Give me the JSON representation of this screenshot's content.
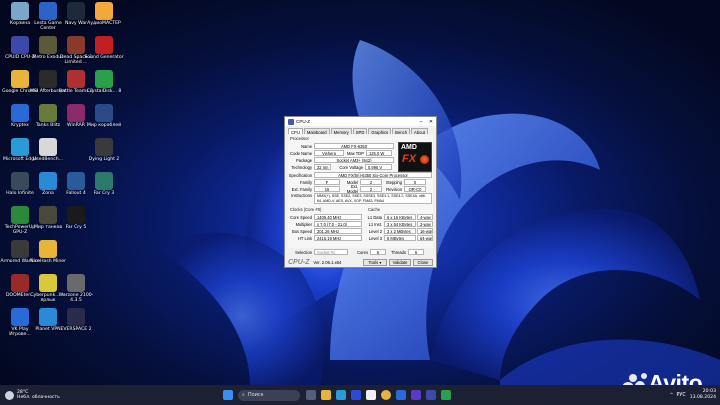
{
  "desktop_icons": [
    {
      "label": "Корзина",
      "color": "#7aa7c7",
      "name": "recycle-bin-icon",
      "col": 0,
      "row": 0
    },
    {
      "label": "Lesta Game Center",
      "color": "#2a64c8",
      "name": "lesta-game-center-icon",
      "col": 1,
      "row": 0
    },
    {
      "label": "Navy War",
      "color": "#1d2a3a",
      "name": "navy-war-icon",
      "col": 2,
      "row": 0
    },
    {
      "label": "АудиоМАСТЕР",
      "color": "#f2a83a",
      "name": "audiomaster-icon",
      "col": 3,
      "row": 0
    },
    {
      "label": "CPUID CPU-Z",
      "color": "#3b4aa8",
      "name": "cpu-z-icon",
      "col": 0,
      "row": 1
    },
    {
      "label": "Metro Exodus",
      "color": "#5a5a3a",
      "name": "metro-exodus-icon",
      "col": 1,
      "row": 1
    },
    {
      "label": "Dead Space 3 Limited ...",
      "color": "#8a3a2a",
      "name": "dead-space-icon",
      "col": 2,
      "row": 1
    },
    {
      "label": "Sound Generator",
      "color": "#c02020",
      "name": "sound-generator-icon",
      "col": 3,
      "row": 1
    },
    {
      "label": "Google Chrome",
      "color": "#e8b43a",
      "name": "chrome-icon",
      "col": 0,
      "row": 2
    },
    {
      "label": "MSI Afterburner",
      "color": "#2a2a2a",
      "name": "msi-afterburner-icon",
      "col": 1,
      "row": 2
    },
    {
      "label": "Battle Teams 2",
      "color": "#b03030",
      "name": "battle-teams-icon",
      "col": 2,
      "row": 2
    },
    {
      "label": "CrystalDisk... 8",
      "color": "#2aa04a",
      "name": "crystaldisk-icon",
      "col": 3,
      "row": 2
    },
    {
      "label": "Kryptex",
      "color": "#2a6ad8",
      "name": "kryptex-icon",
      "col": 0,
      "row": 3
    },
    {
      "label": "Tanks Blitz",
      "color": "#6a7a3a",
      "name": "tanks-blitz-icon",
      "col": 1,
      "row": 3
    },
    {
      "label": "WinRAR",
      "color": "#8a2a6a",
      "name": "winrar-icon",
      "col": 2,
      "row": 3
    },
    {
      "label": "Мир кораблей",
      "color": "#2a4a8a",
      "name": "mir-korabley-icon",
      "col": 3,
      "row": 3
    },
    {
      "label": "Microsoft Edge",
      "color": "#2a9ad8",
      "name": "edge-icon",
      "col": 0,
      "row": 4
    },
    {
      "label": "UsedBench...",
      "color": "#d8d8d8",
      "name": "userbenchmark-icon",
      "col": 1,
      "row": 4
    },
    {
      "label": "Dying Light 2",
      "color": "#3a3a3a",
      "name": "dying-light-icon",
      "col": 3,
      "row": 4
    },
    {
      "label": "Halo Infinite",
      "color": "#3a4a5a",
      "name": "halo-infinite-icon",
      "col": 0,
      "row": 5
    },
    {
      "label": "Zona",
      "color": "#2a8ad8",
      "name": "zona-icon",
      "col": 1,
      "row": 5
    },
    {
      "label": "Fallout 4",
      "color": "#2a5a9a",
      "name": "fallout4-icon",
      "col": 2,
      "row": 5
    },
    {
      "label": "Far Cry 3",
      "color": "#2a7a6a",
      "name": "farcry3-icon",
      "col": 3,
      "row": 5
    },
    {
      "label": "TechPowerUp GPU-Z",
      "color": "#2a8a3a",
      "name": "gpu-z-icon",
      "col": 0,
      "row": 6
    },
    {
      "label": "Мир танков",
      "color": "#4a4a3a",
      "name": "mir-tankov-icon",
      "col": 1,
      "row": 6
    },
    {
      "label": "Far Cry 5",
      "color": "#1a1a1a",
      "name": "farcry5-icon",
      "col": 2,
      "row": 6
    },
    {
      "label": "Armored Warfare",
      "color": "#3a3a3a",
      "name": "armored-warfare-icon",
      "col": 0,
      "row": 7
    },
    {
      "label": "NiceHash Miner",
      "color": "#e8b43a",
      "name": "nicehash-icon",
      "col": 1,
      "row": 7
    },
    {
      "label": "DOOMEter...",
      "color": "#9a2a2a",
      "name": "doom-icon",
      "col": 0,
      "row": 8
    },
    {
      "label": "Cyberpunk... — ярлык",
      "color": "#d8c83a",
      "name": "cyberpunk-icon",
      "col": 1,
      "row": 8
    },
    {
      "label": "Warzone 2100-4.3.5",
      "color": "#6a6a6a",
      "name": "warzone-icon",
      "col": 2,
      "row": 8
    },
    {
      "label": "VK Play Игрове...",
      "color": "#2a6ad8",
      "name": "vk-play-icon",
      "col": 0,
      "row": 9
    },
    {
      "label": "Planet VPN",
      "color": "#2a8ad8",
      "name": "planet-vpn-icon",
      "col": 1,
      "row": 9
    },
    {
      "label": "EVERSPACE 2",
      "color": "#2a2a4a",
      "name": "everspace-icon",
      "col": 2,
      "row": 9
    }
  ],
  "cpuz": {
    "title": "CPU-Z",
    "tabs": [
      "CPU",
      "Mainboard",
      "Memory",
      "SPD",
      "Graphics",
      "Bench",
      "About"
    ],
    "processor_label": "Processor",
    "name_label": "Name",
    "name": "AMD FX-6350",
    "codename_label": "Code Name",
    "codename": "Vishera",
    "maxtdp_label": "Max TDP",
    "maxtdp": "125.0 W",
    "package_label": "Package",
    "package": "Socket AM3+ (942)",
    "technology_label": "Technology",
    "technology": "32 nm",
    "corevoltage_label": "Core Voltage",
    "corevoltage": "0.996 V",
    "spec_label": "Specification",
    "spec": "AMD FX(tm)-6350 Six-Core Processor",
    "family_label": "Family",
    "family": "F",
    "model_label": "Model",
    "model": "2",
    "stepping_label": "Stepping",
    "stepping": "0",
    "extfamily_label": "Ext. Family",
    "extfamily": "15",
    "extmodel_label": "Ext. Model",
    "extmodel": "2",
    "revision_label": "Revision",
    "revision": "OR-C0",
    "instr_label": "Instructions",
    "instr": "MMX(+), SSE, SSE2, SSE3, SSSE3, SSE4.1, SSE4.2, SSE4A, x86-64, AMD-V, AES, AVX, XOP, FMA3, FMA4",
    "clocks_label": "Clocks (Core #0)",
    "corespeed_label": "Core Speed",
    "corespeed": "1405.40 MHz",
    "multiplier_label": "Multiplier",
    "multiplier": "x 7.0 (7.0 - 21.0)",
    "busspeed_label": "Bus Speed",
    "busspeed": "201.26 MHz",
    "htlink_label": "HT Link",
    "htlink": "2416.19 MHz",
    "cache_label": "Cache",
    "l1d_label": "L1 Data",
    "l1d": "6 x 16 KBytes",
    "l1d_way": "4-way",
    "l1i_label": "L1 Inst.",
    "l1i": "3 x 64 KBytes",
    "l1i_way": "2-way",
    "l2_label": "Level 2",
    "l2": "3 x 2 MBytes",
    "l2_way": "16-way",
    "l3_label": "Level 3",
    "l3": "8 MBytes",
    "l3_way": "64-way",
    "selection_label": "Selection",
    "selection": "Socket #1",
    "cores_label": "Cores",
    "cores": "6",
    "threads_label": "Threads",
    "threads": "6",
    "brand": "CPU-Z",
    "version": "Ver. 2.06.1.x64",
    "tools_label": "Tools",
    "validate_label": "Validate",
    "close_label": "Close",
    "logo_amd": "AMD",
    "logo_fx": "FX"
  },
  "taskbar": {
    "weather_temp": "28°C",
    "weather_desc": "Небл. облачность",
    "search_placeholder": "Поиск",
    "lang": "РУС",
    "time": "20:03",
    "date": "13.08.2024"
  },
  "watermark": "Avito"
}
